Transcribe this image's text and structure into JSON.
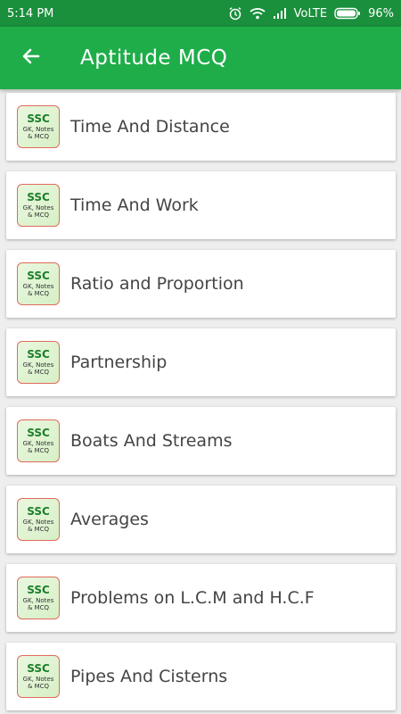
{
  "status_bar": {
    "time": "5:14 PM",
    "network": "VoLTE",
    "battery": "96%"
  },
  "header": {
    "title": "Aptitude MCQ"
  },
  "icon_badge": {
    "line1": "SSC",
    "line2": "GK, Notes",
    "line3": "& MCQ"
  },
  "topics": [
    {
      "label": "Time And Distance"
    },
    {
      "label": "Time And Work"
    },
    {
      "label": "Ratio and Proportion"
    },
    {
      "label": "Partnership"
    },
    {
      "label": "Boats And Streams"
    },
    {
      "label": "Averages"
    },
    {
      "label": "Problems on L.C.M and H.C.F"
    },
    {
      "label": "Pipes And Cisterns"
    }
  ],
  "colors": {
    "app_bar": "#1fad4a",
    "status_bar": "#1a8f3c"
  }
}
